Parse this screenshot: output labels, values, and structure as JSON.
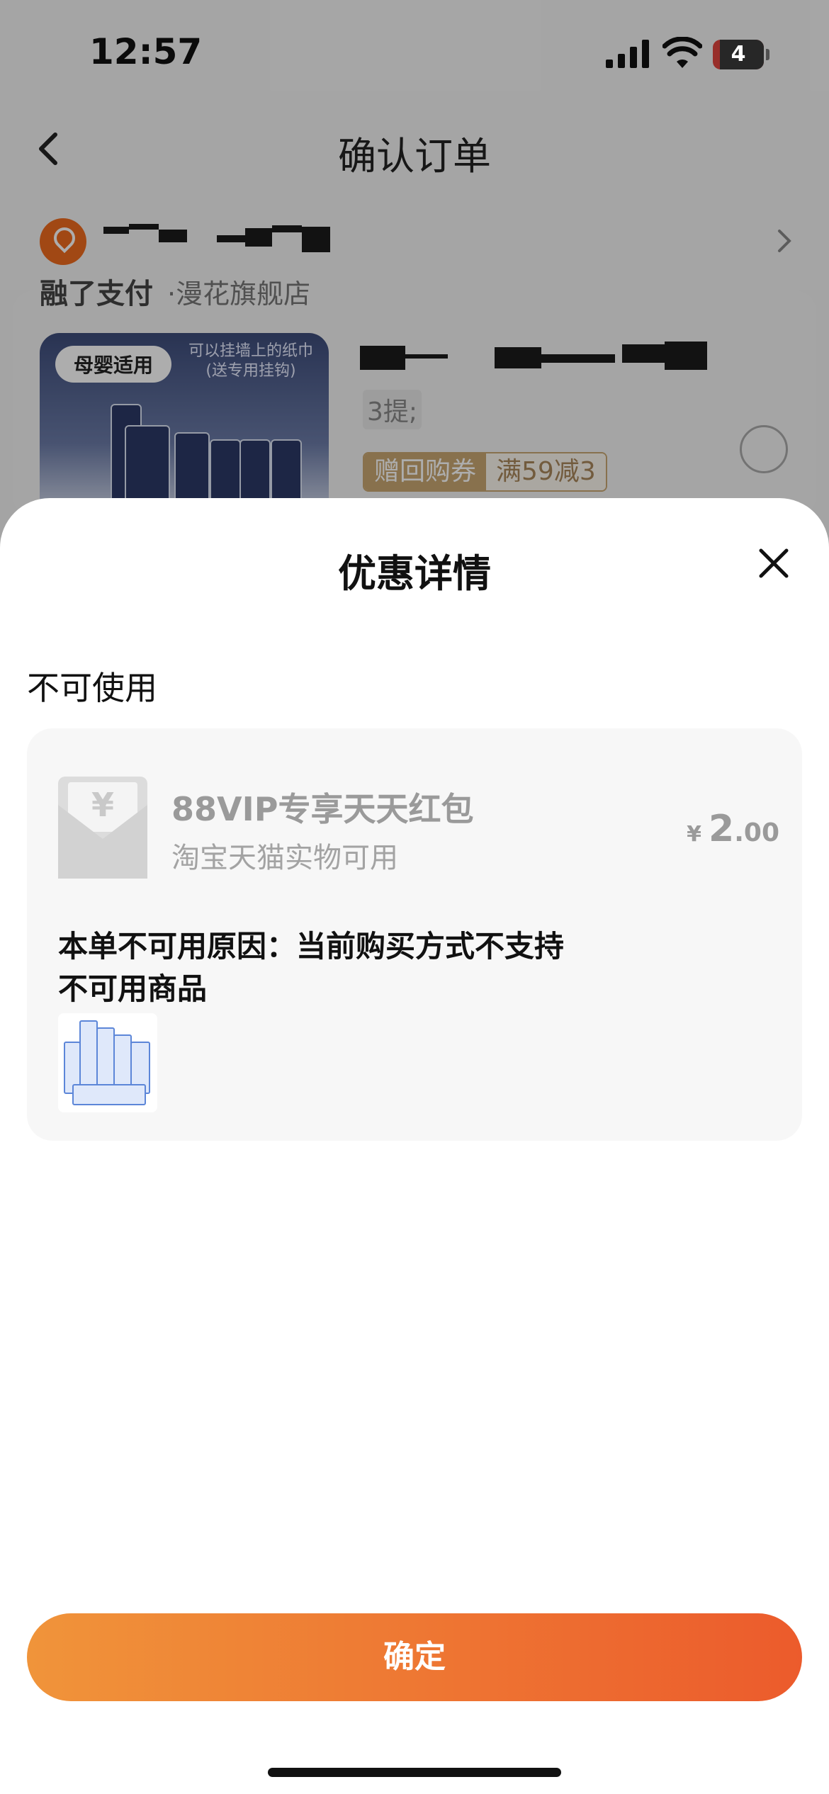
{
  "status_bar": {
    "time": "12:57",
    "battery_level": "4"
  },
  "nav": {
    "title": "确认订单"
  },
  "order": {
    "store_line": "融了支付",
    "store_name": "·漫花旗舰店",
    "product": {
      "badge": "母婴适用",
      "image_caption_line1": "可以挂墙上的纸巾",
      "image_caption_line2": "(送专用挂钩)",
      "spec": "3提;",
      "coupon_tag_left": "赠回购券",
      "coupon_tag_right": "满59减3"
    }
  },
  "sheet": {
    "title": "优惠详情",
    "section_label": "不可使用",
    "coupon": {
      "name": "88VIP专享天天红包",
      "scope": "淘宝天猫实物可用",
      "currency": "¥",
      "amount_int": "2",
      "amount_dec": ".00",
      "reason": "本单不可用原因：当前购买方式不支持",
      "unusable_items_label": "不可用商品"
    },
    "confirm_label": "确定"
  },
  "colors": {
    "accent_start": "#f0943a",
    "accent_end": "#ec5b2c",
    "location_icon": "#ee6a1e",
    "coupon_tag_gold": "#c9a772"
  },
  "icons": [
    "back-chevron-icon",
    "location-pin-icon",
    "chevron-right-icon",
    "close-icon",
    "red-envelope-icon",
    "signal-icon",
    "wifi-icon",
    "battery-icon"
  ]
}
